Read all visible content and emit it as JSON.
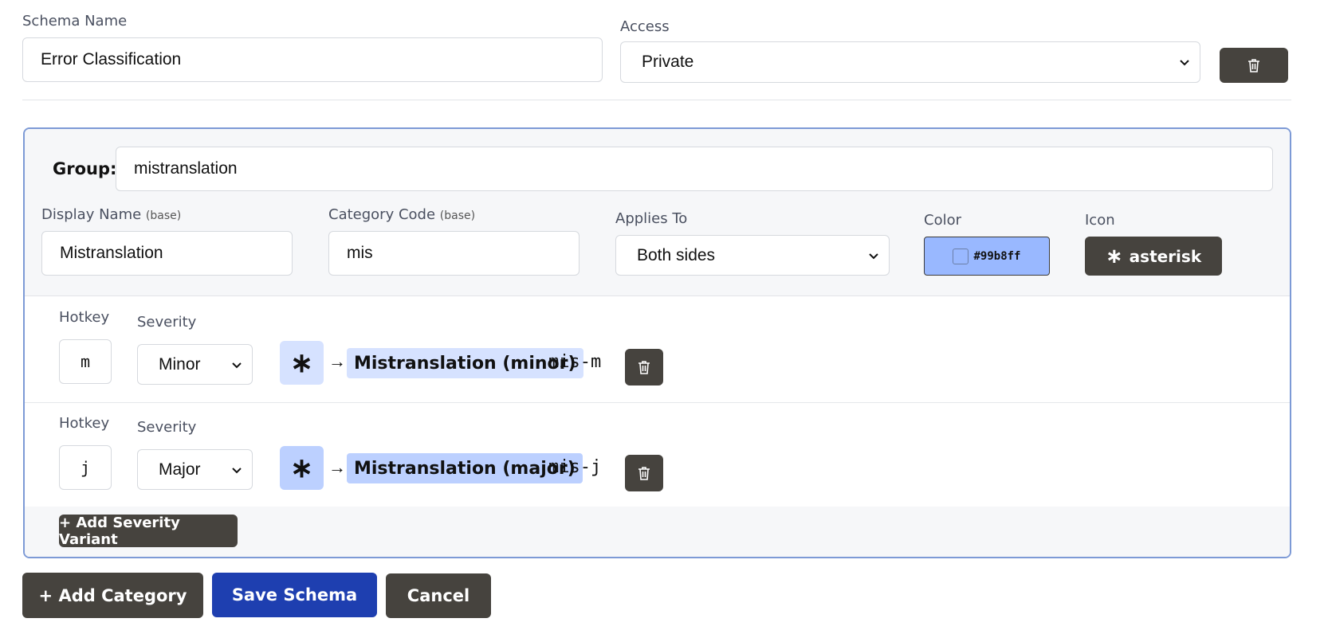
{
  "schema": {
    "name_label": "Schema Name",
    "name_value": "Error Classification",
    "access_label": "Access",
    "access_value": "Private"
  },
  "group": {
    "label": "Group:",
    "value": "mistranslation"
  },
  "fields": {
    "display_name_label": "Display Name",
    "display_name_hint": "(base)",
    "display_name_value": "Mistranslation",
    "category_code_label": "Category Code",
    "category_code_hint": "(base)",
    "category_code_value": "mis",
    "applies_to_label": "Applies To",
    "applies_to_value": "Both sides",
    "color_label": "Color",
    "color_value": "#99b8ff",
    "icon_label": "Icon",
    "icon_glyph": "∗",
    "icon_name": "asterisk"
  },
  "variants": [
    {
      "hotkey_label": "Hotkey",
      "hotkey": "m",
      "severity_label": "Severity",
      "severity": "Minor",
      "icon_glyph": "∗",
      "arrow": "→",
      "result_name": "Mistranslation (minor)",
      "result_code": "mis-m",
      "chip_color": "#d6e2ff"
    },
    {
      "hotkey_label": "Hotkey",
      "hotkey": "j",
      "severity_label": "Severity",
      "severity": "Major",
      "icon_glyph": "∗",
      "arrow": "→",
      "result_name": "Mistranslation (major)",
      "result_code": "mis-j",
      "chip_color": "#bcd0ff"
    }
  ],
  "buttons": {
    "add_variant": "+ Add Severity Variant",
    "add_category": "+ Add Category",
    "save": "Save Schema",
    "cancel": "Cancel"
  },
  "colors": {
    "dark_button": "#46433e",
    "primary_button": "#1e3fb0",
    "card_border": "#7d9ad6",
    "swatch": "#99b8ff"
  }
}
